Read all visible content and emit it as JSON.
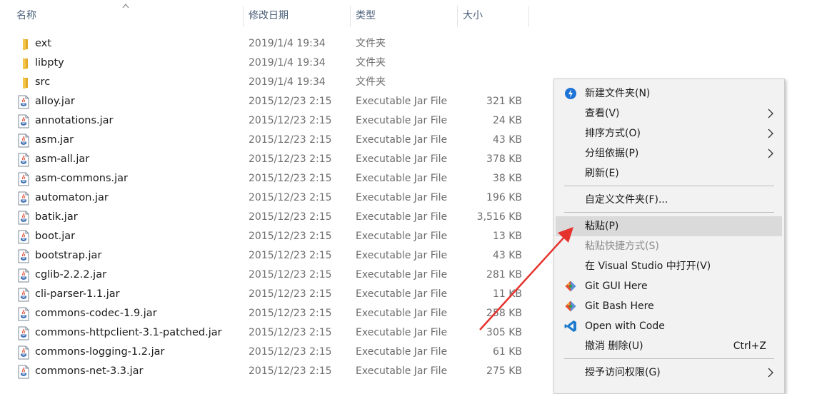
{
  "columns": {
    "name": "名称",
    "date": "修改日期",
    "type": "类型",
    "size": "大小"
  },
  "files": [
    {
      "name": "ext",
      "date": "2019/1/4 19:34",
      "type": "文件夹",
      "size": "",
      "icon": "folder-icon"
    },
    {
      "name": "libpty",
      "date": "2019/1/4 19:34",
      "type": "文件夹",
      "size": "",
      "icon": "folder-icon"
    },
    {
      "name": "src",
      "date": "2019/1/4 19:34",
      "type": "文件夹",
      "size": "",
      "icon": "folder-icon"
    },
    {
      "name": "alloy.jar",
      "date": "2015/12/23 2:15",
      "type": "Executable Jar File",
      "size": "321 KB",
      "icon": "jar-file-icon"
    },
    {
      "name": "annotations.jar",
      "date": "2015/12/23 2:15",
      "type": "Executable Jar File",
      "size": "24 KB",
      "icon": "jar-file-icon"
    },
    {
      "name": "asm.jar",
      "date": "2015/12/23 2:15",
      "type": "Executable Jar File",
      "size": "43 KB",
      "icon": "jar-file-icon"
    },
    {
      "name": "asm-all.jar",
      "date": "2015/12/23 2:15",
      "type": "Executable Jar File",
      "size": "378 KB",
      "icon": "jar-file-icon"
    },
    {
      "name": "asm-commons.jar",
      "date": "2015/12/23 2:15",
      "type": "Executable Jar File",
      "size": "38 KB",
      "icon": "jar-file-icon"
    },
    {
      "name": "automaton.jar",
      "date": "2015/12/23 2:15",
      "type": "Executable Jar File",
      "size": "196 KB",
      "icon": "jar-file-icon"
    },
    {
      "name": "batik.jar",
      "date": "2015/12/23 2:15",
      "type": "Executable Jar File",
      "size": "3,516 KB",
      "icon": "jar-file-icon"
    },
    {
      "name": "boot.jar",
      "date": "2015/12/23 2:15",
      "type": "Executable Jar File",
      "size": "13 KB",
      "icon": "jar-file-icon"
    },
    {
      "name": "bootstrap.jar",
      "date": "2015/12/23 2:15",
      "type": "Executable Jar File",
      "size": "43 KB",
      "icon": "jar-file-icon"
    },
    {
      "name": "cglib-2.2.2.jar",
      "date": "2015/12/23 2:15",
      "type": "Executable Jar File",
      "size": "281 KB",
      "icon": "jar-file-icon"
    },
    {
      "name": "cli-parser-1.1.jar",
      "date": "2015/12/23 2:15",
      "type": "Executable Jar File",
      "size": "11 KB",
      "icon": "jar-file-icon"
    },
    {
      "name": "commons-codec-1.9.jar",
      "date": "2015/12/23 2:15",
      "type": "Executable Jar File",
      "size": "258 KB",
      "icon": "jar-file-icon"
    },
    {
      "name": "commons-httpclient-3.1-patched.jar",
      "date": "2015/12/23 2:15",
      "type": "Executable Jar File",
      "size": "305 KB",
      "icon": "jar-file-icon"
    },
    {
      "name": "commons-logging-1.2.jar",
      "date": "2015/12/23 2:15",
      "type": "Executable Jar File",
      "size": "61 KB",
      "icon": "jar-file-icon"
    },
    {
      "name": "commons-net-3.3.jar",
      "date": "2015/12/23 2:15",
      "type": "Executable Jar File",
      "size": "275 KB",
      "icon": "jar-file-icon"
    }
  ],
  "context_menu": {
    "items": [
      {
        "label": "新建文件夹(N)",
        "icon": "new-folder-icon",
        "submenu": false,
        "disabled": false,
        "highlighted": false,
        "shortcut": ""
      },
      {
        "label": "查看(V)",
        "icon": "",
        "submenu": true,
        "disabled": false,
        "highlighted": false,
        "shortcut": ""
      },
      {
        "label": "排序方式(O)",
        "icon": "",
        "submenu": true,
        "disabled": false,
        "highlighted": false,
        "shortcut": ""
      },
      {
        "label": "分组依据(P)",
        "icon": "",
        "submenu": true,
        "disabled": false,
        "highlighted": false,
        "shortcut": ""
      },
      {
        "label": "刷新(E)",
        "icon": "",
        "submenu": false,
        "disabled": false,
        "highlighted": false,
        "shortcut": ""
      },
      {
        "label": "自定义文件夹(F)...",
        "icon": "",
        "submenu": false,
        "disabled": false,
        "highlighted": false,
        "shortcut": ""
      },
      {
        "label": "粘贴(P)",
        "icon": "",
        "submenu": false,
        "disabled": false,
        "highlighted": true,
        "shortcut": ""
      },
      {
        "label": "粘贴快捷方式(S)",
        "icon": "",
        "submenu": false,
        "disabled": true,
        "highlighted": false,
        "shortcut": ""
      },
      {
        "label": "在 Visual Studio 中打开(V)",
        "icon": "",
        "submenu": false,
        "disabled": false,
        "highlighted": false,
        "shortcut": ""
      },
      {
        "label": "Git GUI Here",
        "icon": "git-icon",
        "submenu": false,
        "disabled": false,
        "highlighted": false,
        "shortcut": ""
      },
      {
        "label": "Git Bash Here",
        "icon": "git-icon",
        "submenu": false,
        "disabled": false,
        "highlighted": false,
        "shortcut": ""
      },
      {
        "label": "Open with Code",
        "icon": "vscode-icon",
        "submenu": false,
        "disabled": false,
        "highlighted": false,
        "shortcut": ""
      },
      {
        "label": "撤消 删除(U)",
        "icon": "",
        "submenu": false,
        "disabled": false,
        "highlighted": false,
        "shortcut": "Ctrl+Z"
      },
      {
        "label": "授予访问权限(G)",
        "icon": "",
        "submenu": true,
        "disabled": false,
        "highlighted": false,
        "shortcut": ""
      }
    ]
  },
  "colors": {
    "folder": "#f3c548",
    "menu_background": "#f2f2f2",
    "menu_highlight": "#dadada",
    "annotation_arrow": "#e5322d",
    "new_folder_icon": "#1e73d6",
    "vscode_icon": "#1f7acb"
  }
}
